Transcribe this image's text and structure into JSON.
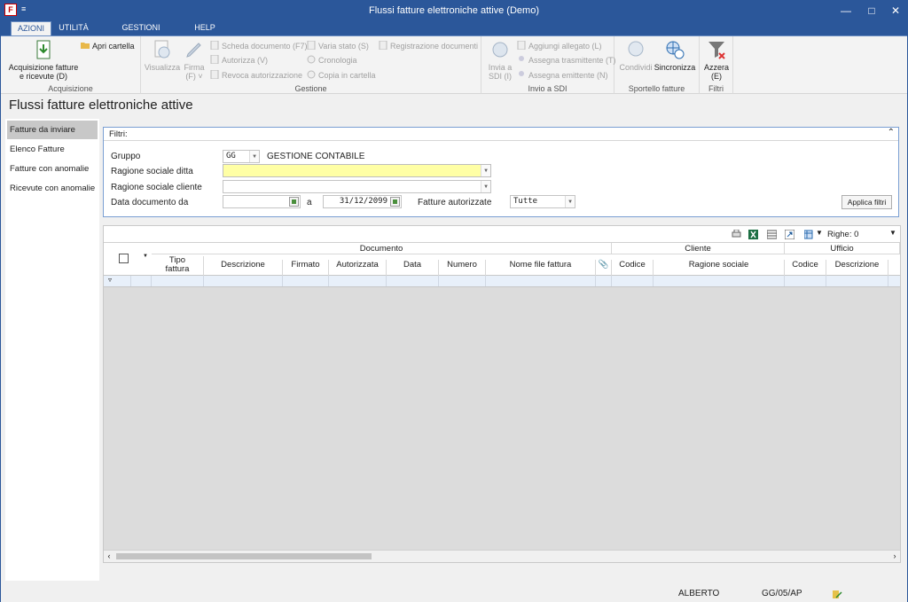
{
  "window": {
    "title": "Flussi fatture elettroniche attive  (Demo)",
    "app_icon": "F",
    "quick_access": "≡"
  },
  "tabs": [
    {
      "label": "AZIONI",
      "active": true
    },
    {
      "label": "UTILITÀ",
      "active": false
    },
    {
      "label": "GESTIONI CORRELATE",
      "active": false
    },
    {
      "label": "HELP",
      "active": false
    }
  ],
  "ribbon": {
    "acquisizione": {
      "group_label": "Acquisizione",
      "acquisizione_fatture": "Acquisizione fatture\ne ricevute (D)",
      "apri_cartella": "Apri cartella"
    },
    "gestione": {
      "group_label": "Gestione",
      "visualizza": "Visualizza",
      "firma": "Firma\n(F) ˅",
      "scheda_documento": "Scheda documento (F7)",
      "autorizza": "Autorizza (V)",
      "revoca_autorizzazione": "Revoca autorizzazione",
      "varia_stato": "Varia stato (S)",
      "cronologia": "Cronologia",
      "copia_in_cartella": "Copia in cartella",
      "registrazione_documenti": "Registrazione documenti"
    },
    "invio_sdi": {
      "group_label": "Invio a SDI",
      "invia_a_sdi": "Invia a\nSDI (I)",
      "aggiungi_allegato": "Aggiungi allegato (L)",
      "assegna_trasmittente": "Assegna trasmittente (T)",
      "assegna_emittente": "Assegna emittente (N)"
    },
    "sportello": {
      "group_label": "Sportello fatture",
      "condividi": "Condividi",
      "sincronizza": "Sincronizza"
    },
    "filtri": {
      "group_label": "Filtri",
      "azzera": "Azzera\n(E)"
    }
  },
  "page_title": "Flussi fatture elettroniche attive",
  "left_nav": [
    {
      "label": "Fatture da inviare",
      "active": true
    },
    {
      "label": "Elenco Fatture",
      "active": false
    },
    {
      "label": "Fatture con anomalie",
      "active": false
    },
    {
      "label": "Ricevute con anomalie",
      "active": false
    }
  ],
  "filters": {
    "header": "Filtri:",
    "gruppo_label": "Gruppo",
    "gruppo_value": "GG",
    "gruppo_desc": "GESTIONE CONTABILE",
    "ragione_ditta_label": "Ragione sociale ditta",
    "ragione_ditta_value": "",
    "ragione_cliente_label": "Ragione sociale cliente",
    "ragione_cliente_value": "",
    "data_da_label": "Data documento da",
    "data_da_value": "",
    "data_a_label": "a",
    "data_a_value": "31/12/2099",
    "autorizzate_label": "Fatture autorizzate",
    "autorizzate_value": "Tutte",
    "apply_button": "Applica filtri"
  },
  "grid": {
    "rows_label": "Righe: 0",
    "groups": {
      "documento": "Documento",
      "cliente": "Cliente",
      "ufficio": "Ufficio"
    },
    "columns": {
      "tipo_fattura": "Tipo\nfattura",
      "descrizione": "Descrizione",
      "firmato": "Firmato",
      "autorizzata": "Autorizzata",
      "data": "Data",
      "numero": "Numero",
      "nome_file": "Nome file fattura",
      "cliente_codice": "Codice",
      "ragione_sociale": "Ragione sociale",
      "ufficio_codice": "Codice",
      "ufficio_descrizione": "Descrizione"
    }
  },
  "status_bar": {
    "user": "ALBERTO",
    "code": "GG/05/AP"
  },
  "colors": {
    "title_bar": "#2b579a",
    "required_field": "#ffffa5",
    "excel_icon": "#1d7044"
  }
}
